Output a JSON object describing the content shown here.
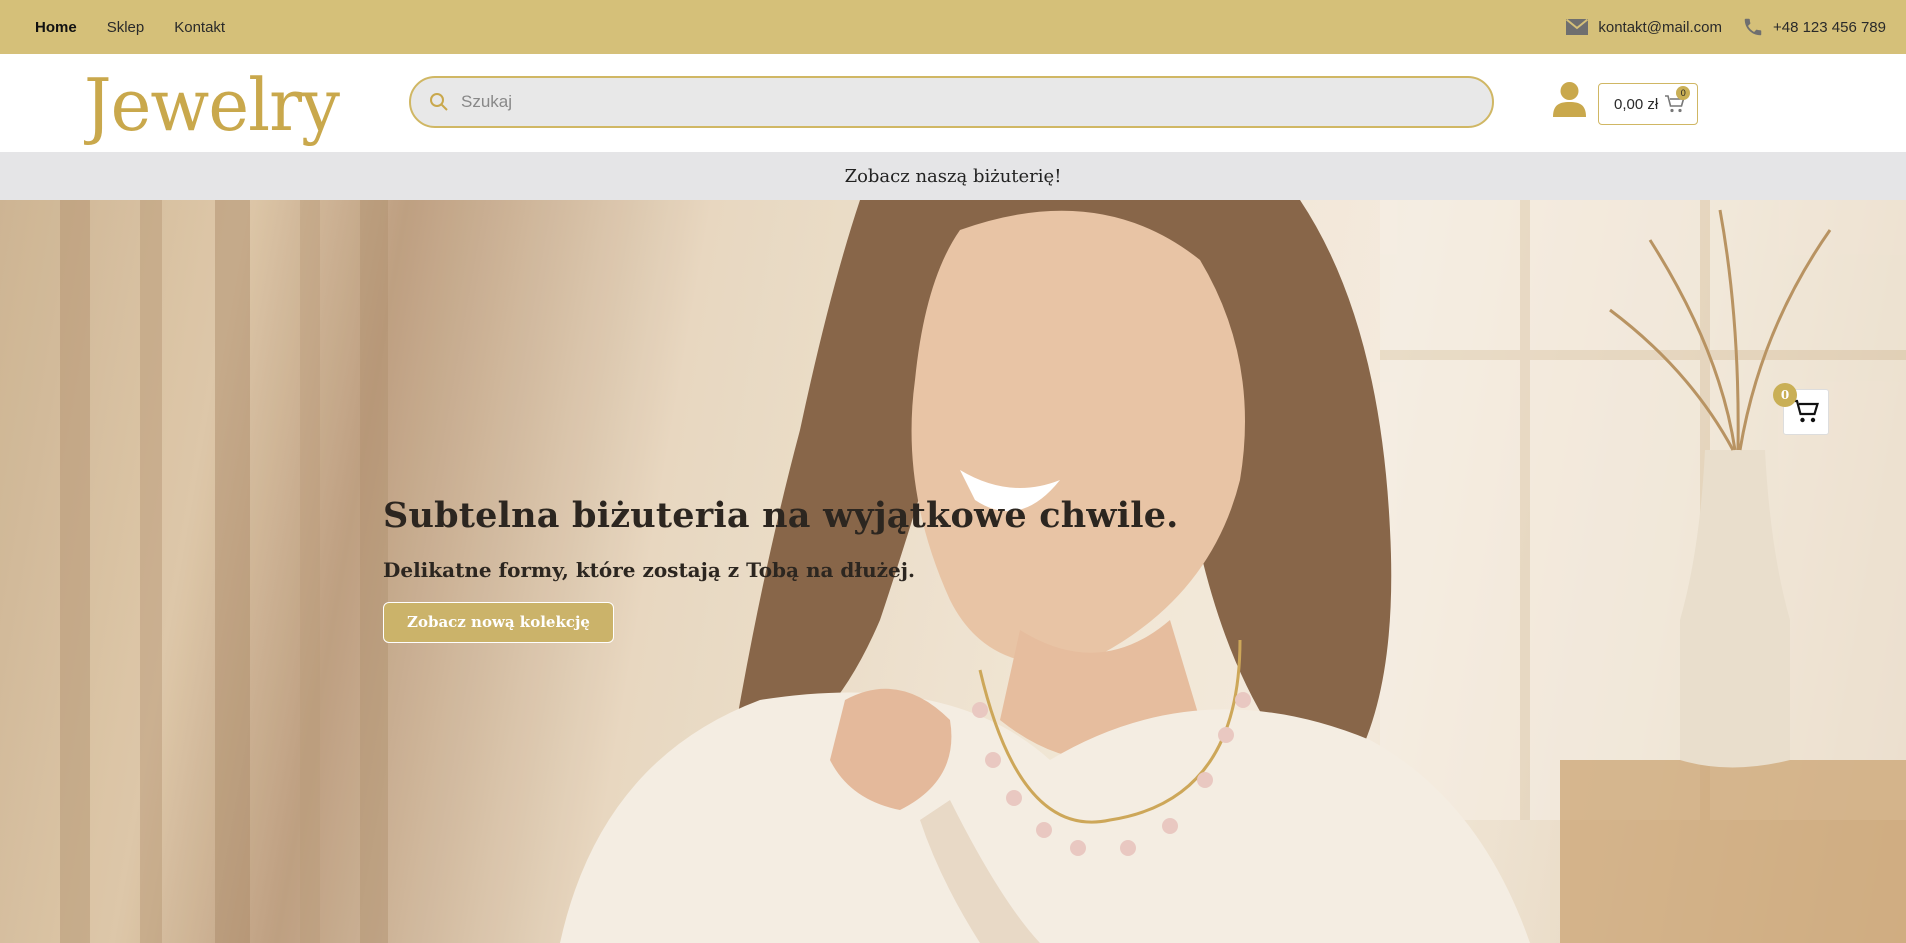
{
  "topbar": {
    "nav": [
      {
        "label": "Home",
        "active": true
      },
      {
        "label": "Sklep",
        "active": false
      },
      {
        "label": "Kontakt",
        "active": false
      }
    ],
    "email": "kontakt@mail.com",
    "email_icon": "envelope-icon",
    "phone": "+48 123 456 789",
    "phone_icon": "phone-icon",
    "color": "#d5c079"
  },
  "header": {
    "logo": "Jewelry",
    "search": {
      "placeholder": "Szukaj",
      "value": ""
    },
    "account_icon": "user-icon",
    "cart": {
      "total": "0,00 zł",
      "count": "0",
      "icon": "cart-icon"
    }
  },
  "announcement": "Zobacz naszą biżuterię!",
  "hero": {
    "title": "Subtelna biżuteria na wyjątkowe chwile.",
    "subtitle": "Delikatne formy, które zostają z Tobą na dłużej.",
    "cta": "Zobacz nową kolekcję",
    "floating_cart_count": "0"
  },
  "colors": {
    "accent": "#d0b764",
    "badge": "#c9af56",
    "announce_bg": "#e5e5e7"
  }
}
